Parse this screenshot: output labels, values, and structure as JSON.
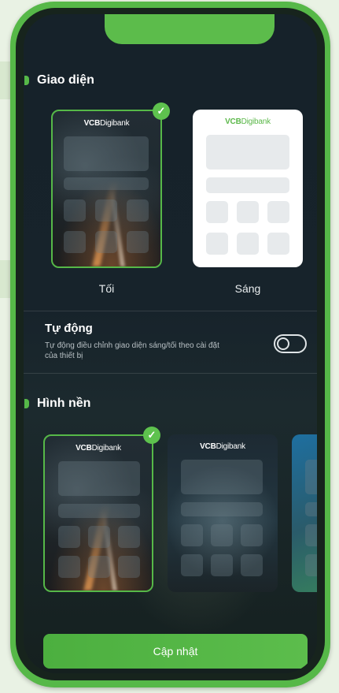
{
  "appearance": {
    "title": "Giao diện",
    "options": [
      {
        "label": "Tối",
        "selected": true
      },
      {
        "label": "Sáng",
        "selected": false
      }
    ]
  },
  "brand": {
    "strong": "VCB",
    "rest": "Digibank"
  },
  "auto": {
    "title": "Tự động",
    "description": "Tự động điều chỉnh giao diện sáng/tối theo cài đặt của thiết bị",
    "enabled": false
  },
  "wallpaper": {
    "title": "Hình nền",
    "selected_index": 0
  },
  "update_button": "Cập nhật",
  "check_glyph": "✓",
  "colors": {
    "accent": "#56b848",
    "screen_bg": "#17232b"
  }
}
